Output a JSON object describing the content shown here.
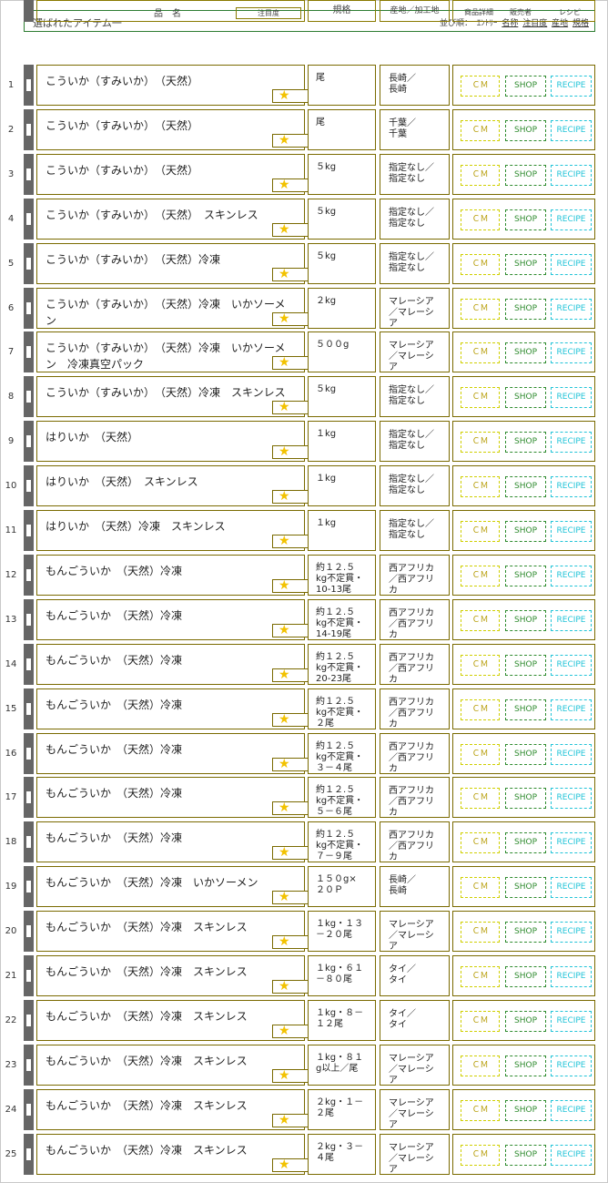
{
  "header": {
    "title": "選ばれたアイテム一",
    "sort_label": "並び順：",
    "sort_entry": "ｴﾝﾄﾘｰ",
    "sort_links": [
      "名称",
      "注目度",
      "産地",
      "規格"
    ]
  },
  "columns": {
    "name": "品　名",
    "attention": "注目度",
    "spec": "規格",
    "origin": "産地／加工地",
    "detail": "商品詳細",
    "seller": "販売者",
    "recipe": "レシピ"
  },
  "buttons": {
    "cm": "ＣＭ",
    "shop": "SHOP",
    "recipe": "RECIPE"
  },
  "rows": [
    {
      "num": "1",
      "name": "こういか（すみいか）　（天然）",
      "spec": "尾",
      "origin": "長崎／\n長崎"
    },
    {
      "num": "2",
      "name": "こういか（すみいか）　（天然）",
      "spec": "尾",
      "origin": "千葉／\n千葉"
    },
    {
      "num": "3",
      "name": "こういか（すみいか）　（天然）",
      "spec": "５kg",
      "origin": "指定なし／\n指定なし"
    },
    {
      "num": "4",
      "name": "こういか（すみいか）　（天然）　スキンレス",
      "spec": "５kg",
      "origin": "指定なし／\n指定なし"
    },
    {
      "num": "5",
      "name": "こういか（すみいか）　（天然）冷凍",
      "spec": "５kg",
      "origin": "指定なし／\n指定なし"
    },
    {
      "num": "6",
      "name": "こういか（すみいか）　（天然）冷凍　いかソーメン",
      "spec": "２kg",
      "origin": "マレーシア\n／マレーシ\nア"
    },
    {
      "num": "7",
      "name": "こういか（すみいか）　（天然）冷凍　いかソーメン　冷凍真空パック",
      "spec": "５００g",
      "origin": "マレーシア\n／マレーシ\nア"
    },
    {
      "num": "8",
      "name": "こういか（すみいか）　（天然）冷凍　スキンレス",
      "spec": "５kg",
      "origin": "指定なし／\n指定なし"
    },
    {
      "num": "9",
      "name": "はりいか　（天然）",
      "spec": "１kg",
      "origin": "指定なし／\n指定なし"
    },
    {
      "num": "10",
      "name": "はりいか　（天然）　スキンレス",
      "spec": "１kg",
      "origin": "指定なし／\n指定なし"
    },
    {
      "num": "11",
      "name": "はりいか　（天然）冷凍　スキンレス",
      "spec": "１kg",
      "origin": "指定なし／\n指定なし"
    },
    {
      "num": "12",
      "name": "もんごういか　（天然）冷凍",
      "spec": "約１２.５\nkg不定貫・\n10-13尾",
      "origin": "西アフリカ\n／西アフリ\nカ"
    },
    {
      "num": "13",
      "name": "もんごういか　（天然）冷凍",
      "spec": "約１２.５\nkg不定貫・\n14-19尾",
      "origin": "西アフリカ\n／西アフリ\nカ"
    },
    {
      "num": "14",
      "name": "もんごういか　（天然）冷凍",
      "spec": "約１２.５\nkg不定貫・\n20-23尾",
      "origin": "西アフリカ\n／西アフリ\nカ"
    },
    {
      "num": "15",
      "name": "もんごういか　（天然）冷凍",
      "spec": "約１２.５\nkg不定貫・\n２尾",
      "origin": "西アフリカ\n／西アフリ\nカ"
    },
    {
      "num": "16",
      "name": "もんごういか　（天然）冷凍",
      "spec": "約１２.５\nkg不定貫・\n３－４尾",
      "origin": "西アフリカ\n／西アフリ\nカ"
    },
    {
      "num": "17",
      "name": "もんごういか　（天然）冷凍",
      "spec": "約１２.５\nkg不定貫・\n５－６尾",
      "origin": "西アフリカ\n／西アフリ\nカ"
    },
    {
      "num": "18",
      "name": "もんごういか　（天然）冷凍",
      "spec": "約１２.５\nkg不定貫・\n７－９尾",
      "origin": "西アフリカ\n／西アフリ\nカ"
    },
    {
      "num": "19",
      "name": "もんごういか　（天然）冷凍　いかソーメン",
      "spec": "１５０g×\n２０Ｐ",
      "origin": "長崎／\n長崎"
    },
    {
      "num": "20",
      "name": "もんごういか　（天然）冷凍　スキンレス",
      "spec": "１kg・１３\n－２０尾",
      "origin": "マレーシア\n／マレーシ\nア"
    },
    {
      "num": "21",
      "name": "もんごういか　（天然）冷凍　スキンレス",
      "spec": "１kg・６１\n－８０尾",
      "origin": "タイ／\nタイ"
    },
    {
      "num": "22",
      "name": "もんごういか　（天然）冷凍　スキンレス",
      "spec": "１kg・８－\n１２尾",
      "origin": "タイ／\nタイ"
    },
    {
      "num": "23",
      "name": "もんごういか　（天然）冷凍　スキンレス",
      "spec": "１kg・８１\ng以上／尾",
      "origin": "マレーシア\n／マレーシ\nア"
    },
    {
      "num": "24",
      "name": "もんごういか　（天然）冷凍　スキンレス",
      "spec": "２kg・１－\n２尾",
      "origin": "マレーシア\n／マレーシ\nア"
    },
    {
      "num": "25",
      "name": "もんごういか　（天然）冷凍　スキンレス",
      "spec": "２kg・３－\n４尾",
      "origin": "マレーシア\n／マレーシ\nア"
    }
  ]
}
